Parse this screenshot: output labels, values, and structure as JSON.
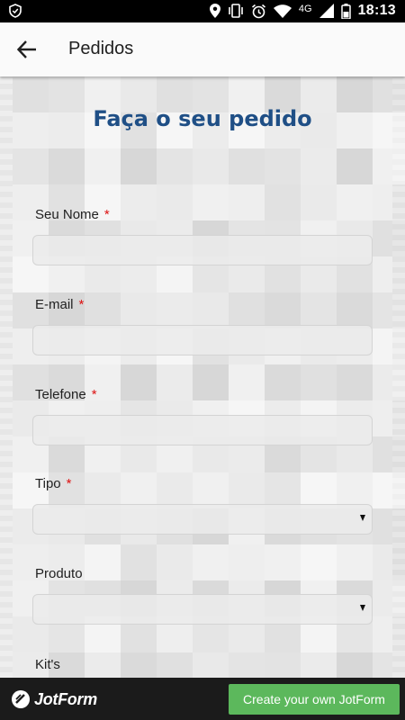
{
  "status_bar": {
    "time": "18:13",
    "network": "4G",
    "icons": [
      "shield-icon",
      "location-icon",
      "vibrate-icon",
      "alarm-icon",
      "wifi-icon",
      "signal-icon",
      "battery-icon"
    ]
  },
  "app_bar": {
    "title": "Pedidos",
    "back_icon": "arrow-left-icon"
  },
  "form": {
    "title": "Faça o seu pedido",
    "required_marker": "*",
    "fields": [
      {
        "label": "Seu Nome",
        "required": true,
        "type": "text",
        "value": ""
      },
      {
        "label": "E-mail",
        "required": true,
        "type": "text",
        "value": ""
      },
      {
        "label": "Telefone",
        "required": true,
        "type": "text",
        "value": ""
      },
      {
        "label": "Tipo",
        "required": true,
        "type": "select",
        "value": ""
      },
      {
        "label": "Produto",
        "required": false,
        "type": "select",
        "value": ""
      },
      {
        "label": "Kit's",
        "required": false,
        "type": "text",
        "value": ""
      }
    ]
  },
  "bottom_bar": {
    "brand": "JotForm",
    "cta_label": "Create your own JotForm"
  },
  "colors": {
    "title": "#1f4f86",
    "required": "#dd1111",
    "cta": "#5cb85c",
    "bottom_bar": "#1b1b1b"
  }
}
